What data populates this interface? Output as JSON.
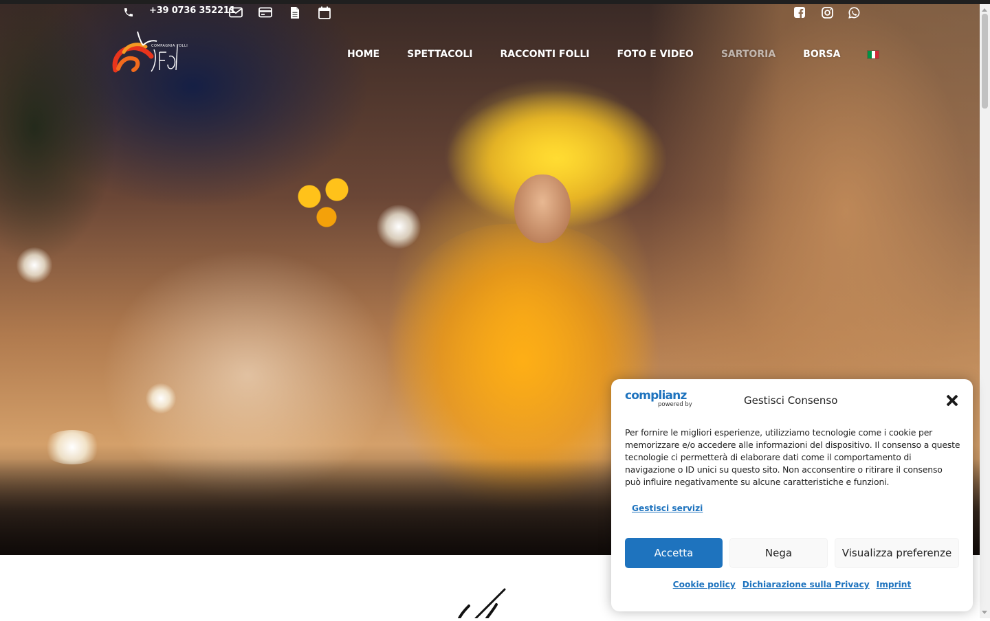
{
  "topbar": {
    "phone": "+39 0736 352211",
    "icons": {
      "phone": "phone-icon",
      "email": "envelope-icon",
      "payment": "credit-card-icon",
      "document": "document-icon",
      "calendar": "calendar-icon",
      "facebook": "facebook-icon",
      "instagram": "instagram-icon",
      "whatsapp": "whatsapp-icon"
    }
  },
  "logo": {
    "text": "COMPAGNIA FOLLI"
  },
  "nav": {
    "items": [
      {
        "label": "HOME"
      },
      {
        "label": "SPETTACOLI"
      },
      {
        "label": "RACCONTI FOLLI"
      },
      {
        "label": "FOTO E VIDEO"
      },
      {
        "label": "SARTORIA"
      },
      {
        "label": "BORSA"
      }
    ],
    "language_flag": "italy-flag-icon",
    "flag_colors": [
      "#009246",
      "#ffffff",
      "#ce2b37"
    ]
  },
  "cookie": {
    "brand": "complianz",
    "brand_sub": "powered by",
    "title": "Gestisci Consenso",
    "text": "Per fornire le migliori esperienze, utilizziamo tecnologie come i cookie per memorizzare e/o accedere alle informazioni del dispositivo. Il consenso a queste tecnologie ci permetterà di elaborare dati come il comportamento di navigazione o ID unici su questo sito. Non acconsentire o ritirare il consenso può influire negativamente su alcune caratteristiche e funzioni.",
    "manage_services": "Gestisci servizi",
    "accept": "Accetta",
    "deny": "Nega",
    "preferences": "Visualizza preferenze",
    "links": [
      "Cookie policy",
      "Dichiarazione sulla Privacy",
      "Imprint"
    ],
    "accent_color": "#1e73be"
  }
}
